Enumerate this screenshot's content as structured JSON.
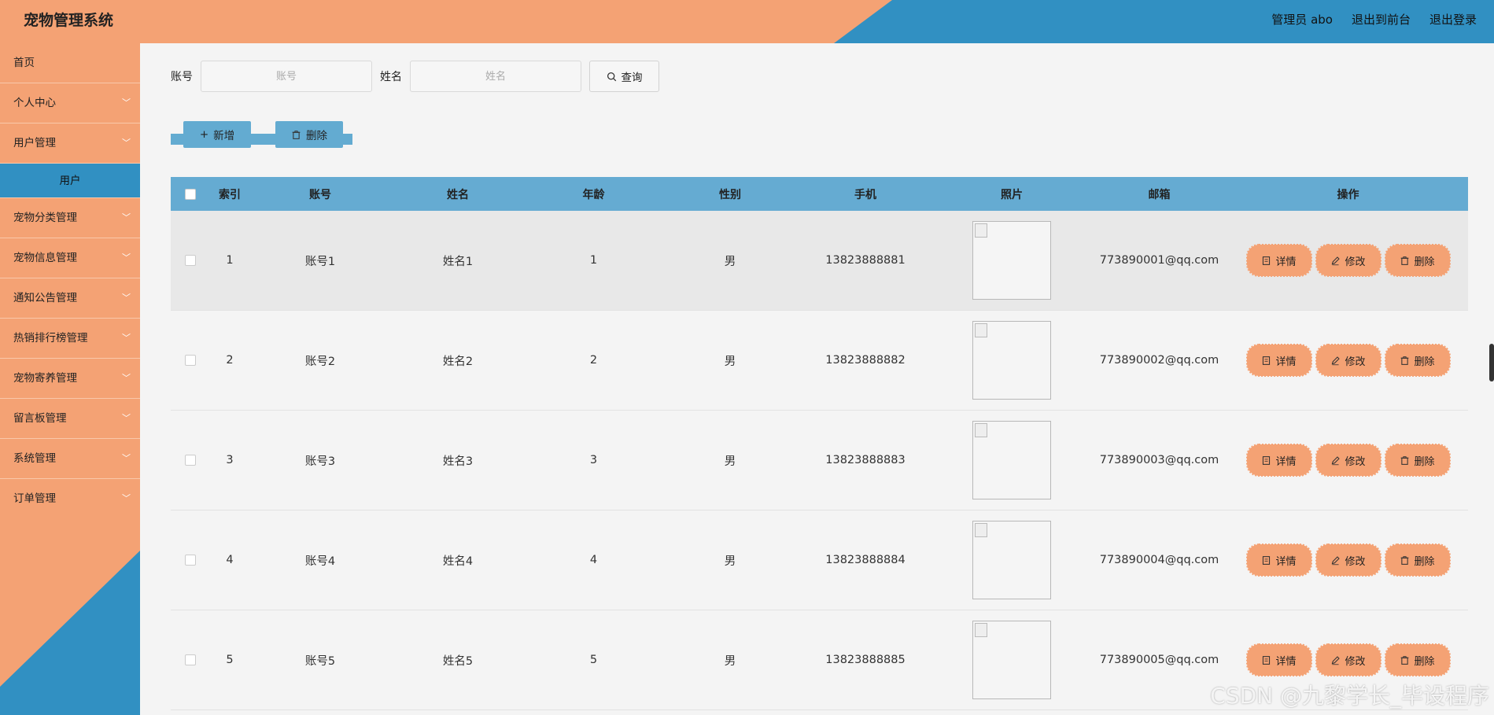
{
  "header": {
    "title": "宠物管理系统",
    "admin_label": "管理员 abo",
    "back_front": "退出到前台",
    "logout": "退出登录"
  },
  "sidebar": {
    "items": [
      {
        "label": "首页",
        "has_arrow": false
      },
      {
        "label": "个人中心",
        "has_arrow": true
      },
      {
        "label": "用户管理",
        "has_arrow": true
      },
      {
        "label": "宠物分类管理",
        "has_arrow": true
      },
      {
        "label": "宠物信息管理",
        "has_arrow": true
      },
      {
        "label": "通知公告管理",
        "has_arrow": true
      },
      {
        "label": "热销排行榜管理",
        "has_arrow": true
      },
      {
        "label": "宠物寄养管理",
        "has_arrow": true
      },
      {
        "label": "留言板管理",
        "has_arrow": true
      },
      {
        "label": "系统管理",
        "has_arrow": true
      },
      {
        "label": "订单管理",
        "has_arrow": true
      }
    ],
    "active_sub": "用户"
  },
  "search": {
    "account_label": "账号",
    "account_placeholder": "账号",
    "name_label": "姓名",
    "name_placeholder": "姓名",
    "query_label": "查询"
  },
  "actions": {
    "add_label": "新增",
    "delete_label": "删除"
  },
  "table": {
    "headers": {
      "index": "索引",
      "account": "账号",
      "name": "姓名",
      "age": "年龄",
      "gender": "性别",
      "phone": "手机",
      "photo": "照片",
      "email": "邮箱",
      "ops": "操作"
    },
    "ops": {
      "detail": "详情",
      "edit": "修改",
      "delete": "删除"
    },
    "rows": [
      {
        "index": "1",
        "account": "账号1",
        "name": "姓名1",
        "age": "1",
        "gender": "男",
        "phone": "13823888881",
        "email": "773890001@qq.com"
      },
      {
        "index": "2",
        "account": "账号2",
        "name": "姓名2",
        "age": "2",
        "gender": "男",
        "phone": "13823888882",
        "email": "773890002@qq.com"
      },
      {
        "index": "3",
        "account": "账号3",
        "name": "姓名3",
        "age": "3",
        "gender": "男",
        "phone": "13823888883",
        "email": "773890003@qq.com"
      },
      {
        "index": "4",
        "account": "账号4",
        "name": "姓名4",
        "age": "4",
        "gender": "男",
        "phone": "13823888884",
        "email": "773890004@qq.com"
      },
      {
        "index": "5",
        "account": "账号5",
        "name": "姓名5",
        "age": "5",
        "gender": "男",
        "phone": "13823888885",
        "email": "773890005@qq.com"
      }
    ]
  },
  "watermark": "CSDN @九黎学长_毕设程序",
  "colors": {
    "accent_orange": "#f4a274",
    "accent_blue": "#3190c2",
    "header_row": "#65abd2"
  }
}
